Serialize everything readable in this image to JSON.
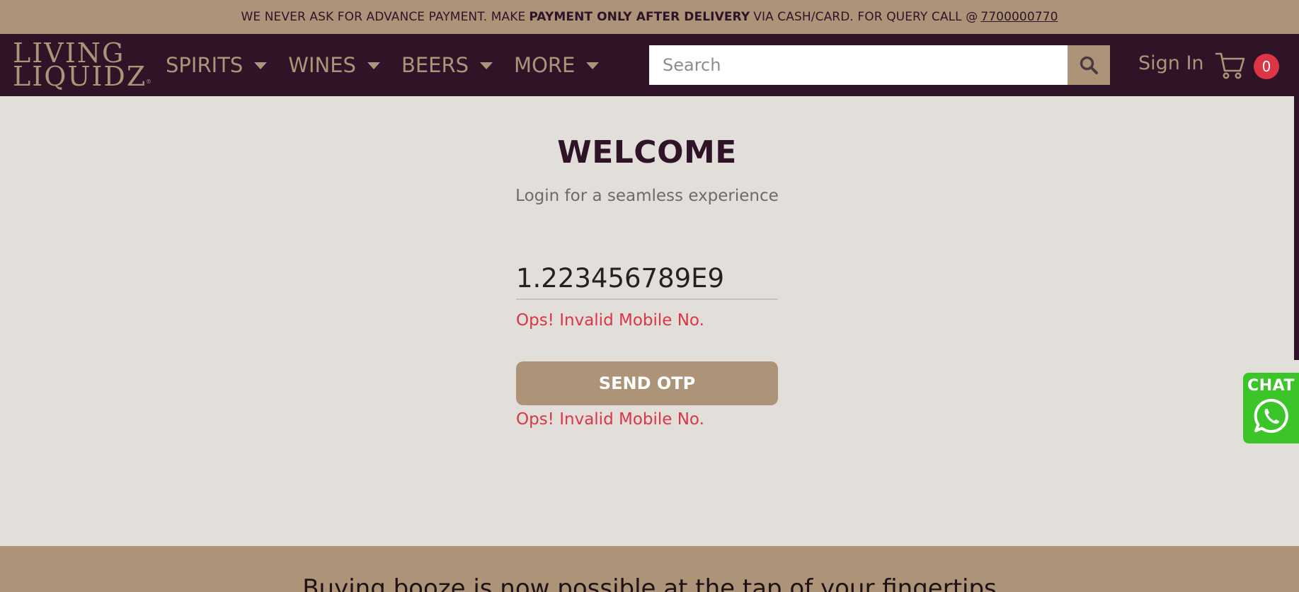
{
  "announcement": {
    "text_before": "WE NEVER ASK FOR ADVANCE PAYMENT. MAKE",
    "bold": "PAYMENT ONLY AFTER DELIVERY",
    "text_after": "VIA CASH/CARD. FOR QUERY CALL @",
    "phone": "7700000770"
  },
  "header": {
    "logo_line1": "LIVING",
    "logo_line2": "LIQUIDZ",
    "logo_mark": "®",
    "menu": [
      {
        "label": "SPIRITS"
      },
      {
        "label": "WINES"
      },
      {
        "label": "BEERS"
      },
      {
        "label": "MORE"
      }
    ],
    "search_placeholder": "Search",
    "search_icon": "search-icon",
    "signin_label": "Sign In",
    "cart_icon": "cart-icon",
    "cart_count": "0"
  },
  "login": {
    "title": "WELCOME",
    "subtitle": "Login for a seamless experience",
    "mobile_value": "1.223456789E9",
    "error_message": "Ops! Invalid Mobile No.",
    "send_otp_label": "SEND OTP",
    "error_message_2": "Ops! Invalid Mobile No."
  },
  "chat_widget": {
    "label": "CHAT",
    "icon": "whatsapp-icon"
  },
  "footer": {
    "tagline": "Buying booze is now possible at the tap of your fingertips"
  },
  "colors": {
    "brand_dark": "#2f1428",
    "brand_tan": "#ad9378",
    "page_bg": "#e2dfdb",
    "error": "#dc3545",
    "whatsapp_green": "#3cc529"
  }
}
